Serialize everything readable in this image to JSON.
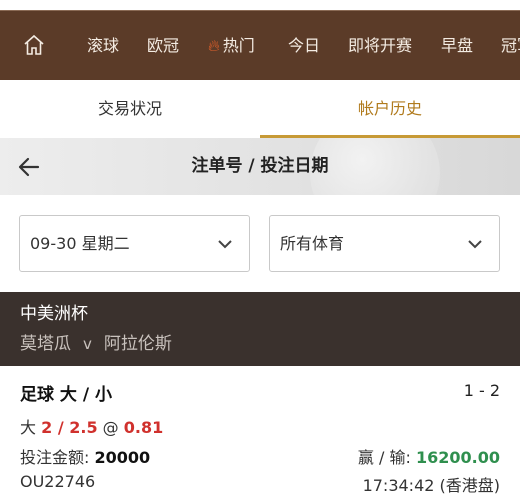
{
  "nav": {
    "home_icon": "home-icon",
    "items": [
      {
        "label": "滚球"
      },
      {
        "label": "欧冠"
      },
      {
        "label": "热门",
        "icon": "flame-icon"
      },
      {
        "label": "今日"
      },
      {
        "label": "即将开赛"
      },
      {
        "label": "早盘"
      },
      {
        "label": "冠军"
      }
    ]
  },
  "tabs": [
    {
      "label": "交易状况",
      "active": false
    },
    {
      "label": "帐户历史",
      "active": true
    }
  ],
  "titlebar": {
    "title": "注单号 / 投注日期",
    "back_icon": "arrow-left-icon"
  },
  "filters": {
    "date": "09-30 星期二",
    "sport": "所有体育"
  },
  "match": {
    "competition": "中美洲杯",
    "home": "莫塔瓜",
    "vs": "v",
    "away": "阿拉伦斯"
  },
  "bet": {
    "type": "足球 大 / 小",
    "score": "1 - 2",
    "side": "大",
    "line": "2 / 2.5",
    "at": "@",
    "odds": "0.81",
    "stake_label": "投注金额:",
    "stake_value": "20000",
    "winloss_label": "赢 / 输:",
    "winloss_value": "16200.00",
    "ticket_id": "OU22746",
    "time": "17:34:42 (香港盘)"
  },
  "colors": {
    "nav_bg": "#5b3b28",
    "tab_active": "#b07a1c",
    "match_header_bg": "#3a312d",
    "odds_red": "#d0312d",
    "win_green": "#2f8f4e"
  }
}
